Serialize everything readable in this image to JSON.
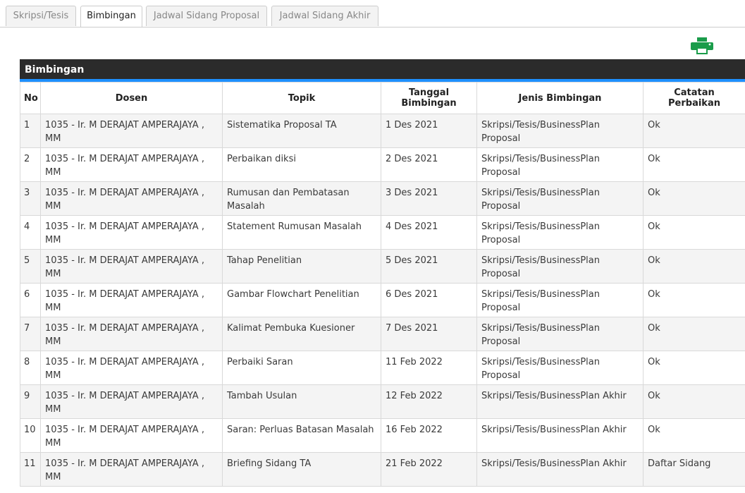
{
  "tabs": [
    {
      "label": "Skripsi/Tesis",
      "active": false
    },
    {
      "label": "Bimbingan",
      "active": true
    },
    {
      "label": "Jadwal Sidang Proposal",
      "active": false
    },
    {
      "label": "Jadwal Sidang Akhir",
      "active": false
    }
  ],
  "toolbar": {
    "print_icon": "printer-icon",
    "print_color": "#1a9c4a"
  },
  "panel": {
    "title": "Bimbingan",
    "accent": "#1e90ff",
    "columns": {
      "no": "No",
      "dosen": "Dosen",
      "topik": "Topik",
      "tanggal_1": "Tanggal",
      "tanggal_2": "Bimbingan",
      "jenis": "Jenis Bimbingan",
      "catatan_1": "Catatan",
      "catatan_2": "Perbaikan"
    },
    "rows": [
      {
        "no": "1",
        "dosen": "1035 - Ir. M DERAJAT AMPERAJAYA , MM",
        "topik": "Sistematika Proposal TA",
        "tanggal": "1 Des 2021",
        "jenis": "Skripsi/Tesis/BusinessPlan Proposal",
        "catatan": "Ok"
      },
      {
        "no": "2",
        "dosen": "1035 - Ir. M DERAJAT AMPERAJAYA , MM",
        "topik": "Perbaikan diksi",
        "tanggal": "2 Des 2021",
        "jenis": "Skripsi/Tesis/BusinessPlan Proposal",
        "catatan": "Ok"
      },
      {
        "no": "3",
        "dosen": "1035 - Ir. M DERAJAT AMPERAJAYA , MM",
        "topik": "Rumusan dan Pembatasan Masalah",
        "tanggal": "3 Des 2021",
        "jenis": "Skripsi/Tesis/BusinessPlan Proposal",
        "catatan": "Ok"
      },
      {
        "no": "4",
        "dosen": "1035 - Ir. M DERAJAT AMPERAJAYA , MM",
        "topik": "Statement Rumusan Masalah",
        "tanggal": "4 Des 2021",
        "jenis": "Skripsi/Tesis/BusinessPlan Proposal",
        "catatan": "Ok"
      },
      {
        "no": "5",
        "dosen": "1035 - Ir. M DERAJAT AMPERAJAYA , MM",
        "topik": "Tahap Penelitian",
        "tanggal": "5 Des 2021",
        "jenis": "Skripsi/Tesis/BusinessPlan Proposal",
        "catatan": "Ok"
      },
      {
        "no": "6",
        "dosen": "1035 - Ir. M DERAJAT AMPERAJAYA , MM",
        "topik": "Gambar Flowchart Penelitian",
        "tanggal": "6 Des 2021",
        "jenis": "Skripsi/Tesis/BusinessPlan Proposal",
        "catatan": "Ok"
      },
      {
        "no": "7",
        "dosen": "1035 - Ir. M DERAJAT AMPERAJAYA , MM",
        "topik": "Kalimat Pembuka Kuesioner",
        "tanggal": "7 Des 2021",
        "jenis": "Skripsi/Tesis/BusinessPlan Proposal",
        "catatan": "Ok"
      },
      {
        "no": "8",
        "dosen": "1035 - Ir. M DERAJAT AMPERAJAYA , MM",
        "topik": "Perbaiki Saran",
        "tanggal": "11 Feb 2022",
        "jenis": "Skripsi/Tesis/BusinessPlan Proposal",
        "catatan": "Ok"
      },
      {
        "no": "9",
        "dosen": "1035 - Ir. M DERAJAT AMPERAJAYA , MM",
        "topik": "Tambah Usulan",
        "tanggal": "12 Feb 2022",
        "jenis": "Skripsi/Tesis/BusinessPlan Akhir",
        "catatan": "Ok"
      },
      {
        "no": "10",
        "dosen": "1035 - Ir. M DERAJAT AMPERAJAYA , MM",
        "topik": "Saran: Perluas Batasan Masalah",
        "tanggal": "16 Feb 2022",
        "jenis": "Skripsi/Tesis/BusinessPlan Akhir",
        "catatan": "Ok"
      },
      {
        "no": "11",
        "dosen": "1035 - Ir. M DERAJAT AMPERAJAYA , MM",
        "topik": "Briefing Sidang TA",
        "tanggal": "21 Feb 2022",
        "jenis": "Skripsi/Tesis/BusinessPlan Akhir",
        "catatan": "Daftar Sidang"
      }
    ]
  }
}
